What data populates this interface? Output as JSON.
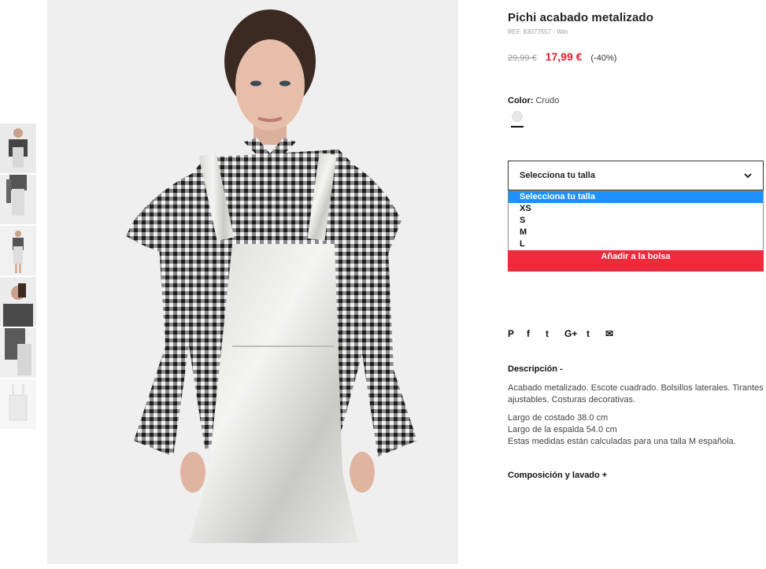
{
  "product": {
    "title": "Pichi acabado metalizado",
    "ref": "REF. 83077557 - Win",
    "old_price": "29,99 €",
    "sale_price": "17,99 €",
    "discount": "(-40%)"
  },
  "color": {
    "label": "Color:",
    "value": "Crudo",
    "swatch_hex": "#e7e7e7"
  },
  "size": {
    "placeholder": "Selecciona tu talla",
    "options": [
      "Selecciona tu talla",
      "XS",
      "S",
      "M",
      "L"
    ],
    "highlighted": "Selecciona tu talla"
  },
  "add_to_bag": "Añadir a la bolsa",
  "social": {
    "pinterest": "P",
    "facebook": "f",
    "twitter": "t",
    "googleplus": "G+",
    "tumblr": "t",
    "email": "✉"
  },
  "description": {
    "heading": "Descripción -",
    "line1": "Acabado metalizado. Escote cuadrado. Bolsillos laterales. Tirantes ajustables. Costuras decorativas.",
    "line2": "Largo de costado 38.0 cm",
    "line3": "Largo de la espalda 54.0 cm",
    "line4": "Estas medidas están calculadas para una talla M española."
  },
  "composition_heading": "Composición y lavado +",
  "colors": {
    "accent_red": "#ee2a3c",
    "price_red": "#e0202f",
    "select_blue": "#1e90ff"
  }
}
